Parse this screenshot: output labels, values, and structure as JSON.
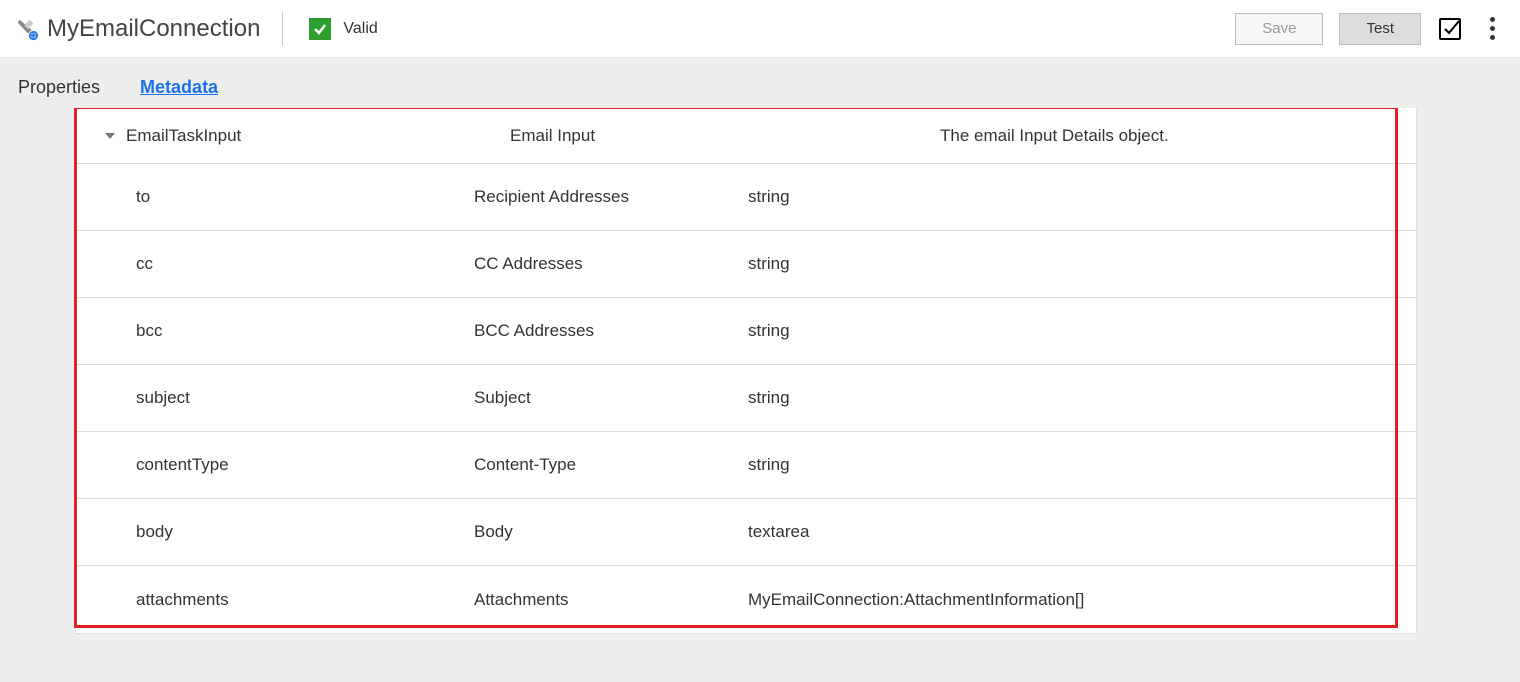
{
  "header": {
    "title": "MyEmailConnection",
    "status_label": "Valid",
    "save_label": "Save",
    "test_label": "Test"
  },
  "tabs": {
    "properties": "Properties",
    "metadata": "Metadata"
  },
  "parent": {
    "name": "EmailTaskInput",
    "label": "Email Input",
    "desc": "The email Input Details object."
  },
  "rows": [
    {
      "name": "to",
      "label": "Recipient Addresses",
      "type": "string"
    },
    {
      "name": "cc",
      "label": "CC Addresses",
      "type": "string"
    },
    {
      "name": "bcc",
      "label": "BCC Addresses",
      "type": "string"
    },
    {
      "name": "subject",
      "label": "Subject",
      "type": "string"
    },
    {
      "name": "contentType",
      "label": "Content-Type",
      "type": "string"
    },
    {
      "name": "body",
      "label": "Body",
      "type": "textarea"
    },
    {
      "name": "attachments",
      "label": "Attachments",
      "type": "MyEmailConnection:AttachmentInformation[]"
    }
  ]
}
